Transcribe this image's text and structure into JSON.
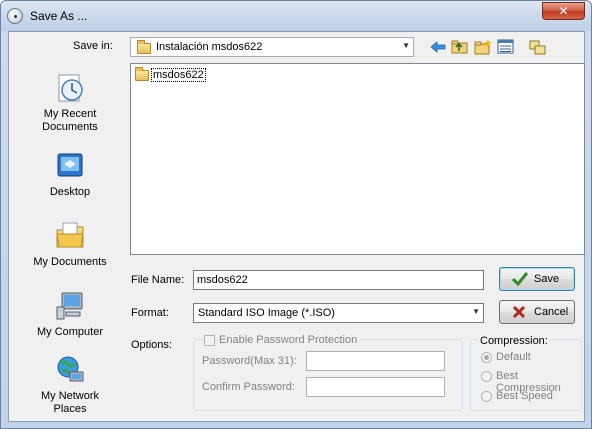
{
  "window": {
    "title": "Save As ...",
    "close_glyph": "✕"
  },
  "savein": {
    "label": "Save in:",
    "value": "Instalación msdos622",
    "toolbar_icons": [
      "back-arrow-icon",
      "up-folder-icon",
      "new-folder-icon",
      "view-menu-icon",
      "preview-icon"
    ]
  },
  "places": [
    {
      "name": "recent",
      "label_line1": "My Recent",
      "label_line2": "Documents",
      "icon": "recent-documents-icon"
    },
    {
      "name": "desktop",
      "label_line1": "Desktop",
      "label_line2": "",
      "icon": "desktop-icon"
    },
    {
      "name": "documents",
      "label_line1": "My Documents",
      "label_line2": "",
      "icon": "my-documents-icon"
    },
    {
      "name": "computer",
      "label_line1": "My Computer",
      "label_line2": "",
      "icon": "my-computer-icon"
    },
    {
      "name": "network",
      "label_line1": "My Network",
      "label_line2": "Places",
      "icon": "network-places-icon"
    }
  ],
  "files": [
    {
      "name": "msdos622",
      "type": "folder"
    }
  ],
  "form": {
    "filename_label": "File Name:",
    "filename_value": "msdos622",
    "format_label": "Format:",
    "format_value": "Standard ISO Image (*.ISO)",
    "options_label": "Options:",
    "enable_password_label": "Enable Password Protection",
    "password_label": "Password(Max 31):",
    "confirm_label": "Confirm Password:"
  },
  "buttons": {
    "save": "Save",
    "cancel": "Cancel"
  },
  "compression": {
    "label": "Compression:",
    "options": [
      "Default",
      "Best Compression",
      "Best Speed"
    ],
    "selected": "Default"
  },
  "colors": {
    "accent": "#3c7fb1",
    "save_check": "#2f8a24",
    "cancel_x": "#b3261e"
  }
}
